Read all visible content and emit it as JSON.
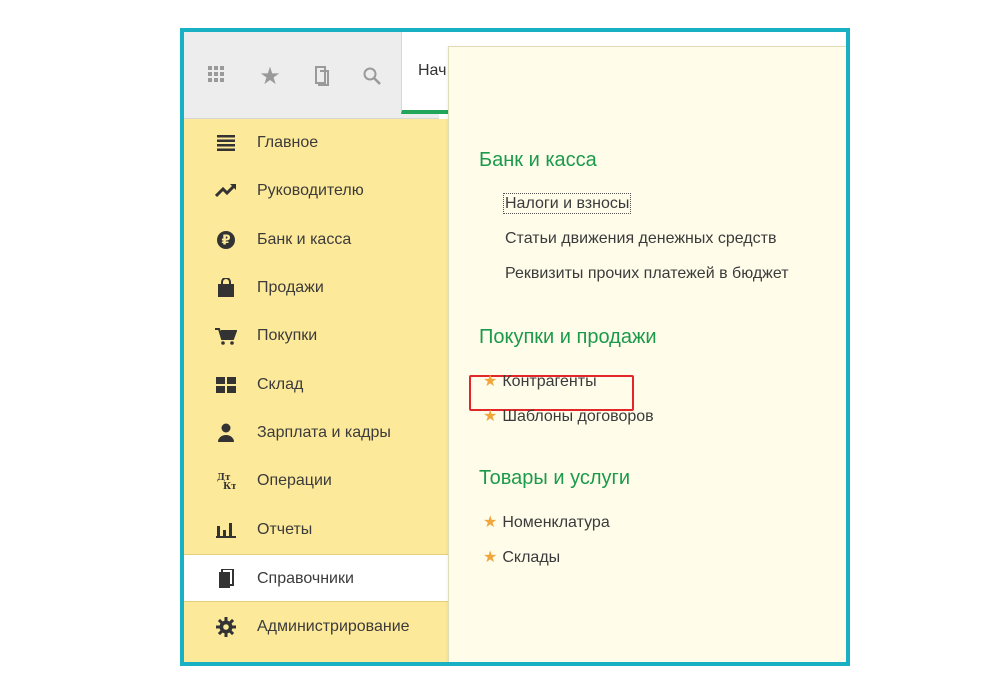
{
  "toolbar": {
    "icons": [
      "apps-grid-icon",
      "star-icon",
      "history-icon",
      "search-icon"
    ],
    "tab_label": "Нач"
  },
  "sidebar": {
    "items": [
      {
        "label": "Главное",
        "icon": "menu-lines-icon"
      },
      {
        "label": "Руководителю",
        "icon": "trend-icon"
      },
      {
        "label": "Банк и касса",
        "icon": "ruble-icon"
      },
      {
        "label": "Продажи",
        "icon": "shopping-bag-icon"
      },
      {
        "label": "Покупки",
        "icon": "cart-icon"
      },
      {
        "label": "Склад",
        "icon": "warehouse-icon"
      },
      {
        "label": "Зарплата и кадры",
        "icon": "person-icon"
      },
      {
        "label": "Операции",
        "icon": "dt-kt-icon"
      },
      {
        "label": "Отчеты",
        "icon": "bar-chart-icon"
      },
      {
        "label": "Справочники",
        "icon": "books-icon",
        "active": true
      },
      {
        "label": "Администрирование",
        "icon": "gear-icon"
      }
    ]
  },
  "panel": {
    "sections": [
      {
        "title": "Банк и касса",
        "links": [
          {
            "label": "Налоги и взносы",
            "favorite": false,
            "focused": true
          },
          {
            "label": "Статьи движения денежных средств",
            "favorite": false
          },
          {
            "label": "Реквизиты прочих платежей в бюджет",
            "favorite": false
          }
        ]
      },
      {
        "title": "Покупки и продажи",
        "links": [
          {
            "label": "Контрагенты",
            "favorite": true,
            "highlighted": true
          },
          {
            "label": "Шаблоны договоров",
            "favorite": true
          }
        ]
      },
      {
        "title": "Товары и услуги",
        "links": [
          {
            "label": "Номенклатура",
            "favorite": true
          },
          {
            "label": "Склады",
            "favorite": true
          }
        ]
      }
    ]
  },
  "colors": {
    "frame_border": "#1ab0c4",
    "sidebar_bg": "#fde99a",
    "panel_bg": "#fffdea",
    "section_title": "#1b9a4b",
    "favorite_star": "#f0a63a",
    "highlight_box": "#e2262a",
    "tab_underline": "#22a65a"
  }
}
